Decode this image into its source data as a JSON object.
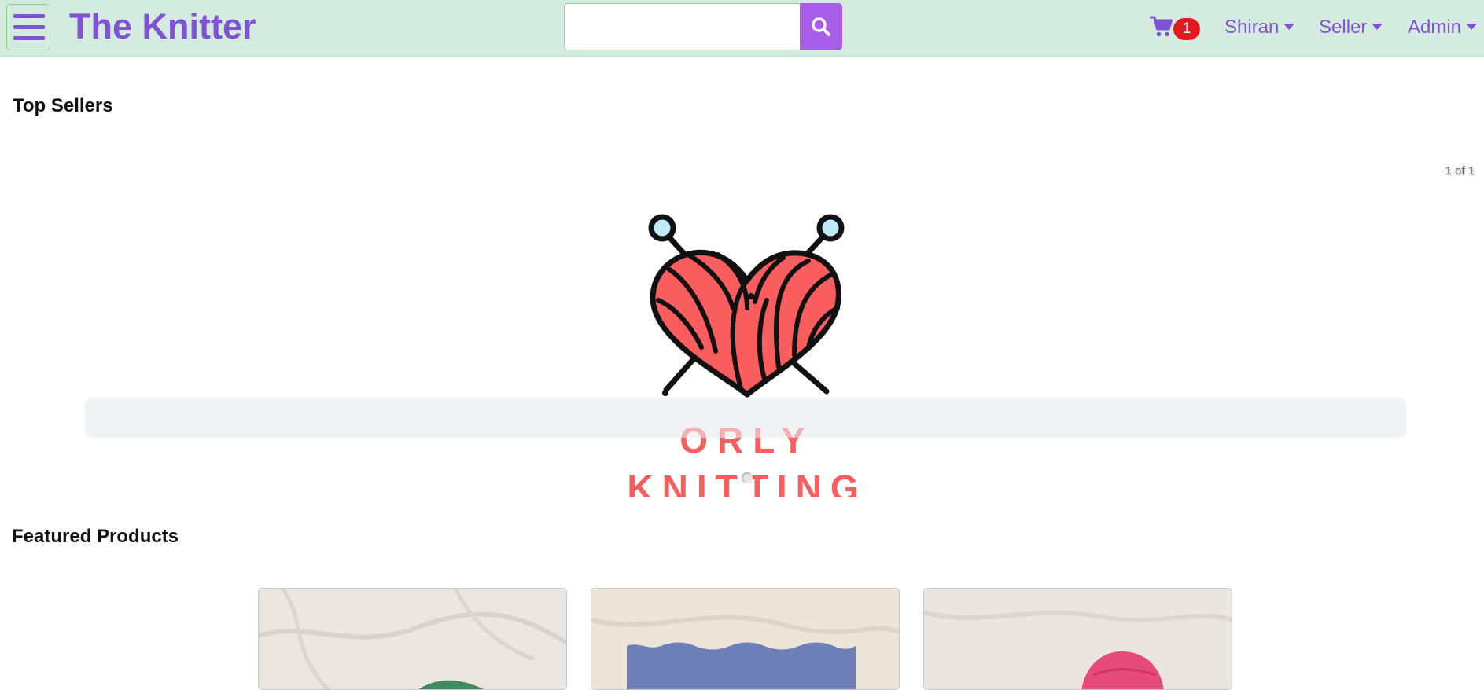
{
  "navbar": {
    "brand": "The Knitter",
    "search": {
      "value": "",
      "placeholder": ""
    },
    "cart_count": "1",
    "dropdowns": {
      "user": "Shiran",
      "seller": "Seller",
      "admin": "Admin"
    }
  },
  "top_sellers": {
    "title": "Top Sellers",
    "counter": "1 of 1",
    "caption": "",
    "slides": [
      {
        "logo_text_line1": "ORLY",
        "logo_text_line2": "KNITTING"
      }
    ]
  },
  "featured": {
    "title": "Featured Products"
  },
  "colors": {
    "brand": "#8052d6",
    "navbar_bg": "#d4ecdf",
    "search_button": "#a75de8",
    "badge": "#e2191f",
    "logo_red": "#fa5d5d"
  }
}
